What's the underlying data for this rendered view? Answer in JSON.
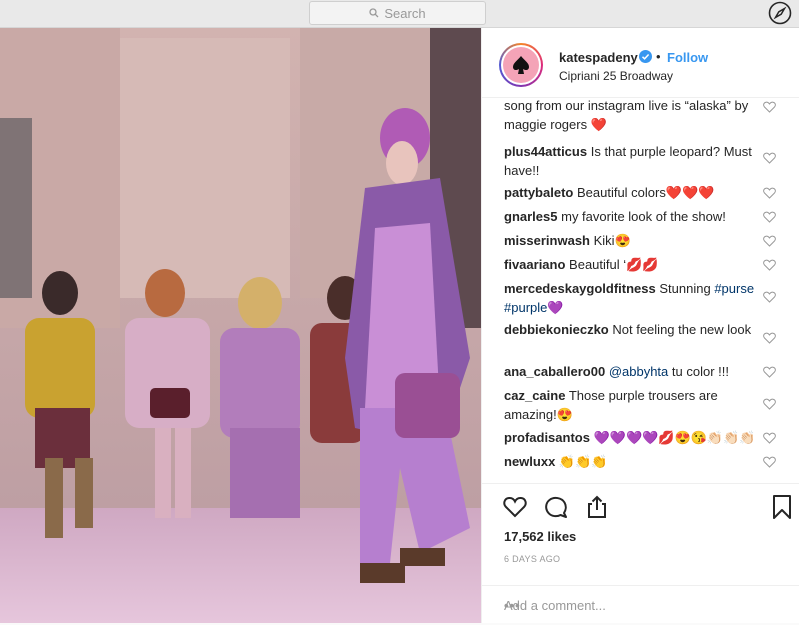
{
  "topbar": {
    "search_placeholder": "Search",
    "search_icon": "search-icon",
    "explore_icon": "compass-icon"
  },
  "post": {
    "username": "katespadeny",
    "follow_label": "Follow",
    "dot": "•",
    "location": "Cipriani 25 Broadway",
    "likes": "17,562 likes",
    "time_ago": "6 DAYS AGO",
    "add_comment_placeholder": "Add a comment...",
    "more_label": "•••"
  },
  "comments": [
    {
      "user": "",
      "text": "song from our instagram live is “alaska” by maggie rogers ❤️"
    },
    {
      "user": "plus44atticus",
      "text": "Is that purple leopard? Must have!!"
    },
    {
      "user": "pattybaleto",
      "text": "Beautiful colors❤️❤️❤️"
    },
    {
      "user": "gnarles5",
      "text": "my favorite look of the show!"
    },
    {
      "user": "misserinwash",
      "text": "Kiki😍"
    },
    {
      "user": "fivaariano",
      "text": "Beautiful ‘💋💋"
    },
    {
      "user": "mercedeskaygoldfitness",
      "text": "Stunning",
      "tags": "#purse #purple💜"
    },
    {
      "user": "debbiekonieczko",
      "text": "Not feeling the new look"
    },
    {
      "user": "ana_caballero00",
      "mention": "@abbyhta",
      "text": "tu color !!!"
    },
    {
      "user": "caz_caine",
      "text": "Those purple trousers are amazing!😍"
    },
    {
      "user": "profadisantos",
      "text": "💜💜💜💜💋😍😘👏🏻👏🏻👏🏻"
    },
    {
      "user": "newluxx",
      "text": "👏👏👏"
    }
  ],
  "colors": {
    "accent": "#3897f0",
    "text": "#262626",
    "muted": "#999999",
    "verified": "#3897f0",
    "avatar_bg": "#f4a3b7"
  }
}
